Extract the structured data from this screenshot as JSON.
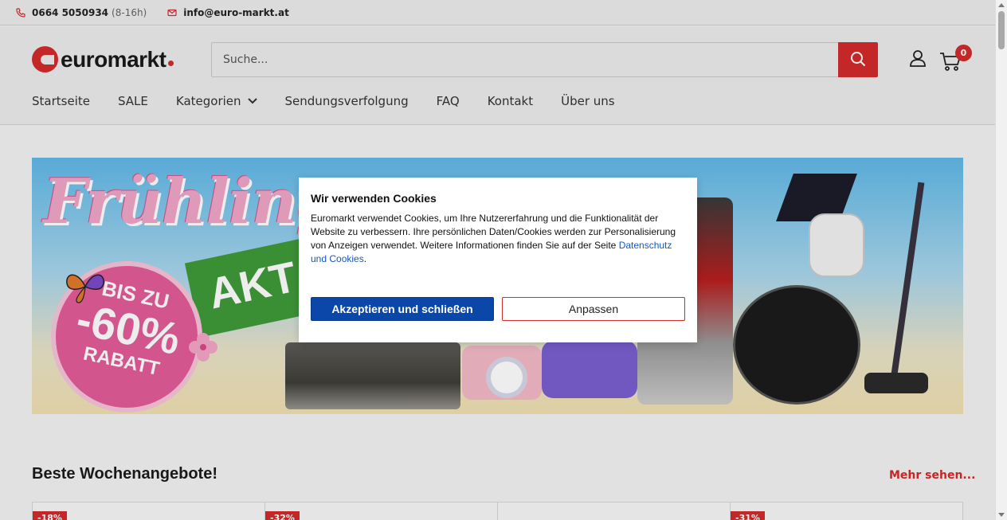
{
  "topbar": {
    "phone": "0664 5050934",
    "phone_hours": "(8-16h)",
    "email": "info@euro-markt.at"
  },
  "header": {
    "logo_text": "euromarkt",
    "search_placeholder": "Suche...",
    "cart_count": "0"
  },
  "nav": {
    "items": [
      "Startseite",
      "SALE",
      "Kategorien",
      "Sendungsverfolgung",
      "FAQ",
      "Kontakt",
      "Über uns"
    ]
  },
  "hero": {
    "title": "Frühlings",
    "green_text": "AKT",
    "circle_l1": "BIS ZU",
    "circle_l2": "-60%",
    "circle_l3": "RABATT"
  },
  "section": {
    "title": "Beste Wochenangebote!",
    "more": "Mehr sehen..."
  },
  "cards": {
    "badges": [
      "-18%",
      "-32%",
      "",
      "-31%"
    ]
  },
  "cookie": {
    "title": "Wir verwenden Cookies",
    "text": "Euromarkt verwendet Cookies, um Ihre Nutzererfahrung und die Funktionalität der Website zu verbessern. Ihre persönlichen Daten/Cookies werden zur Personalisierung von Anzeigen verwendet. Weitere Informationen finden Sie auf der Seite ",
    "link": "Datenschutz und Cookies",
    "after_link": ".",
    "accept": "Akzeptieren und schließen",
    "adjust": "Anpassen"
  },
  "colors": {
    "brand_red": "#d32a2a",
    "accept_blue": "#0a47a9"
  }
}
